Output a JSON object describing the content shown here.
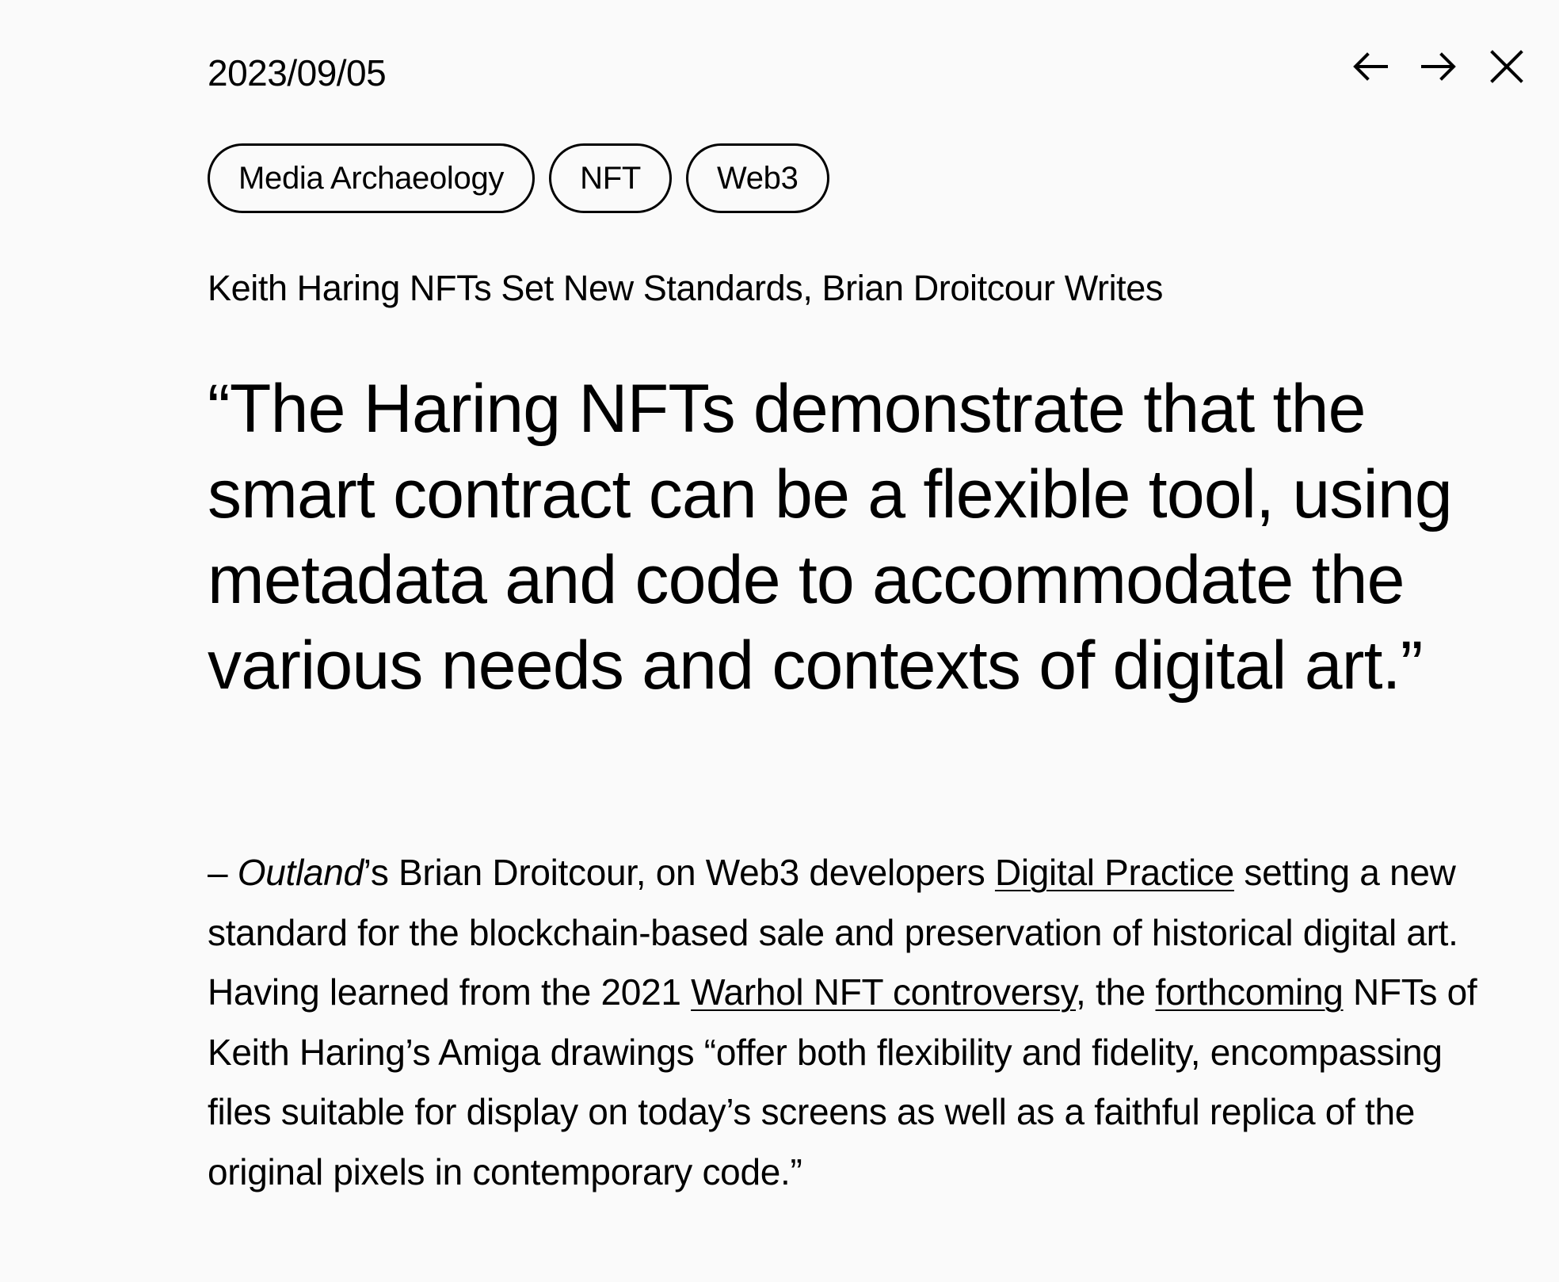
{
  "header": {
    "date": "2023/09/05",
    "prev_icon": "arrow-left-icon",
    "next_icon": "arrow-right-icon",
    "close_icon": "close-icon"
  },
  "tags": [
    {
      "label": "Media Archaeology"
    },
    {
      "label": "NFT"
    },
    {
      "label": "Web3"
    }
  ],
  "article": {
    "headline": "Keith Haring NFTs Set New Standards, Brian Droitcour Writes",
    "quote": "“The Haring NFTs demonstrate that the smart contract can be a flexible tool, using metadata and code to accommodate the various needs and contexts of digital art.”",
    "body": {
      "dash": "– ",
      "publication": "Outland",
      "text_1": "’s Brian Droitcour, on Web3 developers ",
      "link_1": "Digital Practice",
      "text_2": " setting a new standard for the blockchain-based sale and preservation of historical digital art. Having learned from the 2021 ",
      "link_2": "Warhol NFT controversy",
      "text_3": ", the ",
      "link_3": "forthcoming",
      "text_4": " NFTs of Keith Haring’s Amiga drawings “offer both flexibility and fidelity, encompassing files suitable for display on today’s screens as well as a faithful replica of the original pixels in contemporary code.”"
    }
  }
}
